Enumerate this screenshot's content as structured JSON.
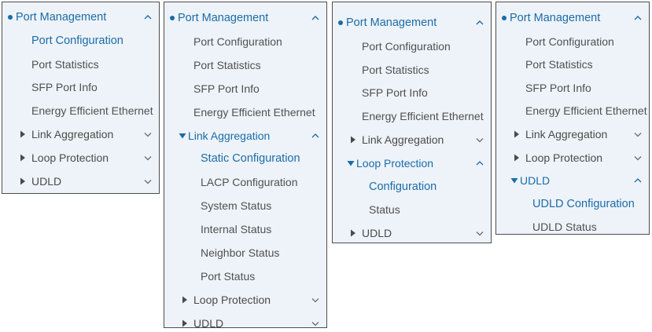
{
  "panels": [
    {
      "title": "Port Management",
      "items": [
        "Port Configuration",
        "Port Statistics",
        "SFP Port Info",
        "Energy Efficient Ethernet"
      ],
      "active_item": "Port Configuration",
      "subgroups": [
        {
          "label": "Link Aggregation",
          "expanded": false,
          "items": []
        },
        {
          "label": "Loop Protection",
          "expanded": false,
          "items": []
        },
        {
          "label": "UDLD",
          "expanded": false,
          "items": []
        }
      ]
    },
    {
      "title": "Port Management",
      "items": [
        "Port Configuration",
        "Port Statistics",
        "SFP Port Info",
        "Energy Efficient Ethernet"
      ],
      "active_item": "",
      "subgroups": [
        {
          "label": "Link Aggregation",
          "expanded": true,
          "items": [
            "Static Configuration",
            "LACP Configuration",
            "System Status",
            "Internal Status",
            "Neighbor Status",
            "Port Status"
          ],
          "active_item": "Static Configuration"
        },
        {
          "label": "Loop Protection",
          "expanded": false,
          "items": []
        },
        {
          "label": "UDLD",
          "expanded": false,
          "items": []
        }
      ]
    },
    {
      "title": "Port Management",
      "items": [
        "Port Configuration",
        "Port Statistics",
        "SFP Port Info",
        "Energy Efficient Ethernet"
      ],
      "active_item": "",
      "subgroups": [
        {
          "label": "Link Aggregation",
          "expanded": false,
          "items": []
        },
        {
          "label": "Loop Protection",
          "expanded": true,
          "items": [
            "Configuration",
            "Status"
          ],
          "active_item": "Configuration"
        },
        {
          "label": "UDLD",
          "expanded": false,
          "items": []
        }
      ]
    },
    {
      "title": "Port Management",
      "items": [
        "Port Configuration",
        "Port Statistics",
        "SFP Port Info",
        "Energy Efficient Ethernet"
      ],
      "active_item": "",
      "subgroups": [
        {
          "label": "Link Aggregation",
          "expanded": false,
          "items": []
        },
        {
          "label": "Loop Protection",
          "expanded": false,
          "items": []
        },
        {
          "label": "UDLD",
          "expanded": true,
          "items": [
            "UDLD Configuration",
            "UDLD Status"
          ],
          "active_item": "UDLD Configuration"
        }
      ]
    }
  ],
  "icons": {
    "bullet": "bullet-dot-icon",
    "collapse": "chevron-up-icon",
    "expand": "chevron-down-icon",
    "collapsed_group": "caret-right-icon",
    "expanded_group": "caret-down-icon"
  },
  "colors": {
    "accent": "#1a6ca8",
    "panel_bg": "#eef3f9",
    "text": "#505050",
    "border": "#4d4d4d"
  }
}
